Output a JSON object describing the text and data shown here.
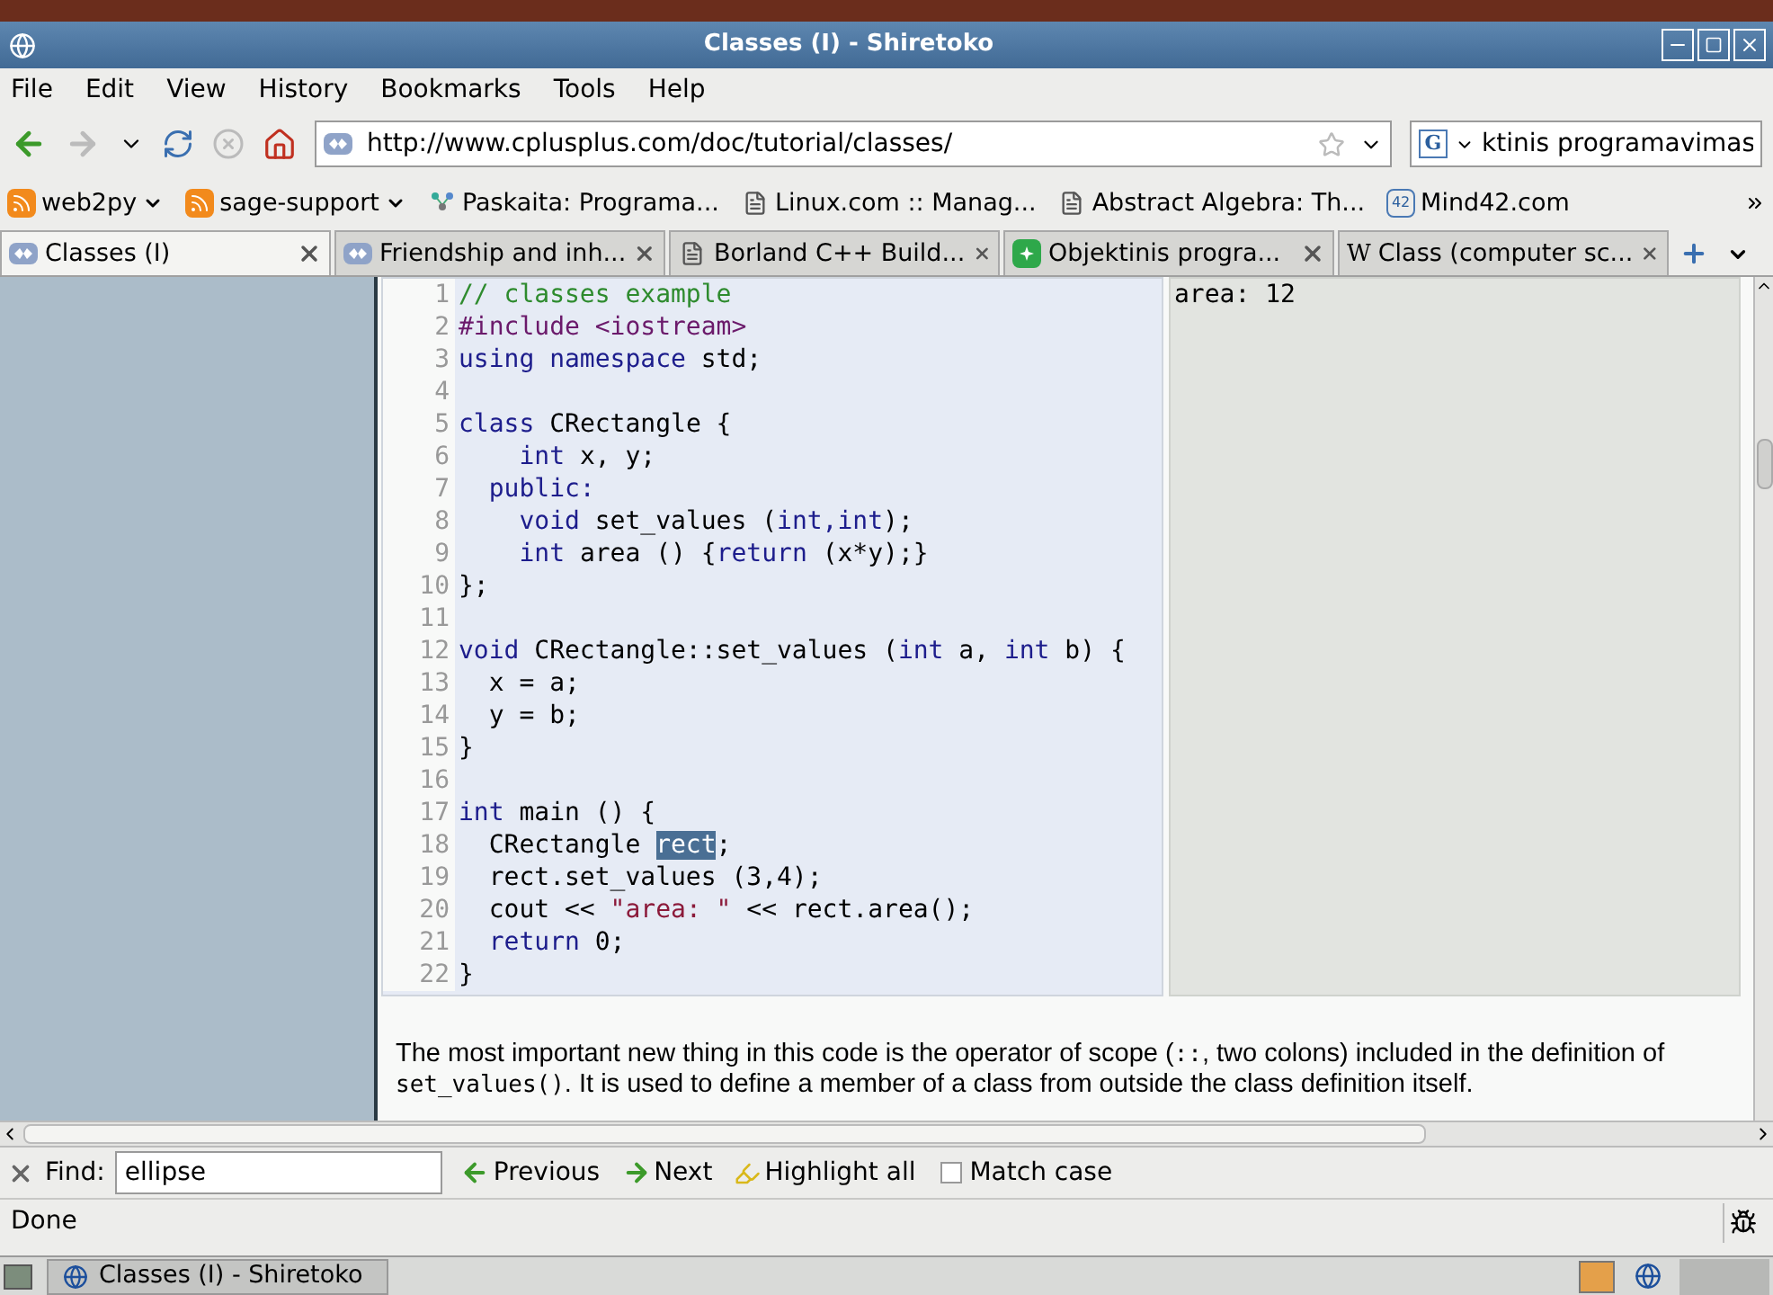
{
  "window": {
    "title": "Classes (I) - Shiretoko"
  },
  "menu": [
    "File",
    "Edit",
    "View",
    "History",
    "Bookmarks",
    "Tools",
    "Help"
  ],
  "navigation": {
    "url": "http://www.cplusplus.com/doc/tutorial/classes/",
    "search_value": "ktinis programavimas",
    "engine_badge": "G"
  },
  "bookmarks": [
    {
      "label": "web2py",
      "kind": "feed"
    },
    {
      "label": "sage-support",
      "kind": "feed"
    },
    {
      "label": "Paskaita: Programa...",
      "kind": "graph"
    },
    {
      "label": "Linux.com :: Manag...",
      "kind": "page"
    },
    {
      "label": "Abstract Algebra: Th...",
      "kind": "page"
    },
    {
      "label": "Mind42.com",
      "kind": "badge",
      "badge": "42"
    }
  ],
  "tabs": [
    {
      "label": "Classes (I)",
      "selected": true,
      "kind": "cpp"
    },
    {
      "label": "Friendship and inh...",
      "selected": false,
      "kind": "cpp"
    },
    {
      "label": "Borland C++ Build...",
      "selected": false,
      "kind": "page"
    },
    {
      "label": "Objektinis progra...",
      "selected": false,
      "kind": "green"
    },
    {
      "label": "Class (computer sc...",
      "selected": false,
      "kind": "wiki",
      "badge": "W"
    }
  ],
  "code": {
    "lines": [
      {
        "number": "1",
        "tokens": [
          {
            "kind": "comment",
            "text": "// classes example"
          }
        ]
      },
      {
        "number": "2",
        "tokens": [
          {
            "kind": "preproc",
            "text": "#include <iostream>"
          }
        ]
      },
      {
        "number": "3",
        "tokens": [
          {
            "kind": "keyword",
            "text": "using namespace"
          },
          {
            "kind": "plain",
            "text": " std;"
          }
        ]
      },
      {
        "number": "4"
      },
      {
        "number": "5",
        "tokens": [
          {
            "kind": "keyword",
            "text": "class"
          },
          {
            "kind": "plain",
            "text": " CRectangle {"
          }
        ]
      },
      {
        "number": "6",
        "tokens": [
          {
            "kind": "keyword",
            "text": "    int"
          },
          {
            "kind": "plain",
            "text": " x, y;"
          }
        ]
      },
      {
        "number": "7",
        "tokens": [
          {
            "kind": "keyword",
            "text": "  public:"
          }
        ]
      },
      {
        "number": "8",
        "tokens": [
          {
            "kind": "keyword",
            "text": "    void"
          },
          {
            "kind": "plain",
            "text": " set_values ("
          },
          {
            "kind": "keyword",
            "text": "int,int"
          },
          {
            "kind": "plain",
            "text": ");"
          }
        ]
      },
      {
        "number": "9",
        "tokens": [
          {
            "kind": "keyword",
            "text": "    int"
          },
          {
            "kind": "plain",
            "text": " area () {"
          },
          {
            "kind": "keyword",
            "text": "return"
          },
          {
            "kind": "plain",
            "text": " (x*y);}"
          }
        ]
      },
      {
        "number": "10",
        "tokens": [
          {
            "kind": "plain",
            "text": "};"
          }
        ]
      },
      {
        "number": "11"
      },
      {
        "number": "12",
        "tokens": [
          {
            "kind": "keyword",
            "text": "void"
          },
          {
            "kind": "plain",
            "text": " CRectangle::set_values ("
          },
          {
            "kind": "keyword",
            "text": "int"
          },
          {
            "kind": "plain",
            "text": " a, "
          },
          {
            "kind": "keyword",
            "text": "int"
          },
          {
            "kind": "plain",
            "text": " b) {"
          }
        ]
      },
      {
        "number": "13",
        "tokens": [
          {
            "kind": "plain",
            "text": "  x = a;"
          }
        ]
      },
      {
        "number": "14",
        "tokens": [
          {
            "kind": "plain",
            "text": "  y = b;"
          }
        ]
      },
      {
        "number": "15",
        "tokens": [
          {
            "kind": "plain",
            "text": "}"
          }
        ]
      },
      {
        "number": "16"
      },
      {
        "number": "17",
        "tokens": [
          {
            "kind": "keyword",
            "text": "int"
          },
          {
            "kind": "plain",
            "text": " main () {"
          }
        ]
      },
      {
        "number": "18",
        "tokens": [
          {
            "kind": "plain",
            "text": "  CRectangle "
          },
          {
            "kind": "selected",
            "text": "rect"
          },
          {
            "kind": "plain",
            "text": ";"
          }
        ]
      },
      {
        "number": "19",
        "tokens": [
          {
            "kind": "plain",
            "text": "  rect.set_values (3,4);"
          }
        ]
      },
      {
        "number": "20",
        "tokens": [
          {
            "kind": "plain",
            "text": "  cout << "
          },
          {
            "kind": "string",
            "text": "\"area: \""
          },
          {
            "kind": "plain",
            "text": " << rect.area();"
          }
        ]
      },
      {
        "number": "21",
        "tokens": [
          {
            "kind": "keyword",
            "text": "  return"
          },
          {
            "kind": "plain",
            "text": " 0;"
          }
        ]
      },
      {
        "number": "22",
        "tokens": [
          {
            "kind": "plain",
            "text": "}"
          }
        ]
      }
    ]
  },
  "output": {
    "text": "area: 12"
  },
  "paragraph": [
    {
      "kind": "text",
      "text": "The most important new thing in this code is the operator of scope ("
    },
    {
      "kind": "code",
      "text": "::"
    },
    {
      "kind": "text",
      "text": ", two colons) included in the definition of "
    },
    {
      "kind": "code",
      "text": "set_values()"
    },
    {
      "kind": "text",
      "text": ". It is used to define a member of a class from outside the class definition itself."
    }
  ],
  "find_bar": {
    "label": "Find:",
    "value": "ellipse",
    "previous": "Previous",
    "next": "Next",
    "highlight": "Highlight all",
    "match_case": {
      "label": "Match case",
      "checked": false
    }
  },
  "status": "Done",
  "taskbar": {
    "task": "Classes (I) - Shiretoko"
  }
}
